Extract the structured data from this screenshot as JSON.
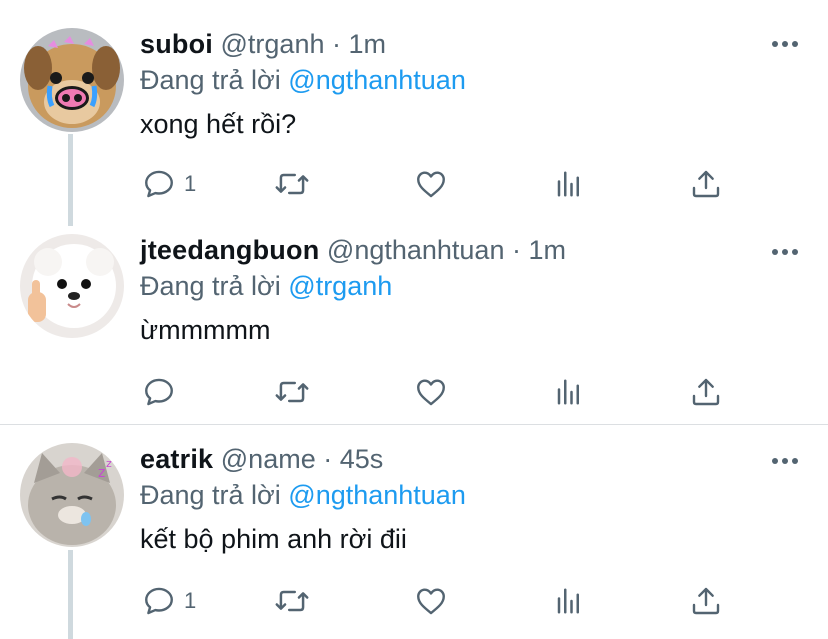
{
  "reply_prefix": "Đang trả lời",
  "tweets": [
    {
      "name": "suboi",
      "handle": "@trganh",
      "separator": "·",
      "time": "1m",
      "reply_to": "@ngthanhtuan",
      "text": "xong hết rồi?",
      "reply_count": "1",
      "avatar_icon": "puppy-filter-avatar"
    },
    {
      "name": "jteedangbuon",
      "handle": "@ngthanhtuan",
      "separator": "·",
      "time": "1m",
      "reply_to": "@trganh",
      "text": "ừmmmmm",
      "reply_count": "",
      "avatar_icon": "white-dog-avatar"
    },
    {
      "name": "eatrik",
      "handle": "@name",
      "separator": "·",
      "time": "45s",
      "reply_to": "@ngthanhtuan",
      "text": "kết bộ phim anh rời đii",
      "reply_count": "1",
      "avatar_icon": "sleepy-cat-avatar"
    }
  ],
  "icons": {
    "reply": "reply-icon",
    "retweet": "retweet-icon",
    "like": "like-icon",
    "analytics": "analytics-icon",
    "share": "share-icon",
    "more": "more-icon"
  },
  "colors": {
    "mention": "#1d9bf0",
    "secondary_text": "#536471",
    "primary_text": "#0f1419",
    "thread_line": "#cfd9de"
  }
}
